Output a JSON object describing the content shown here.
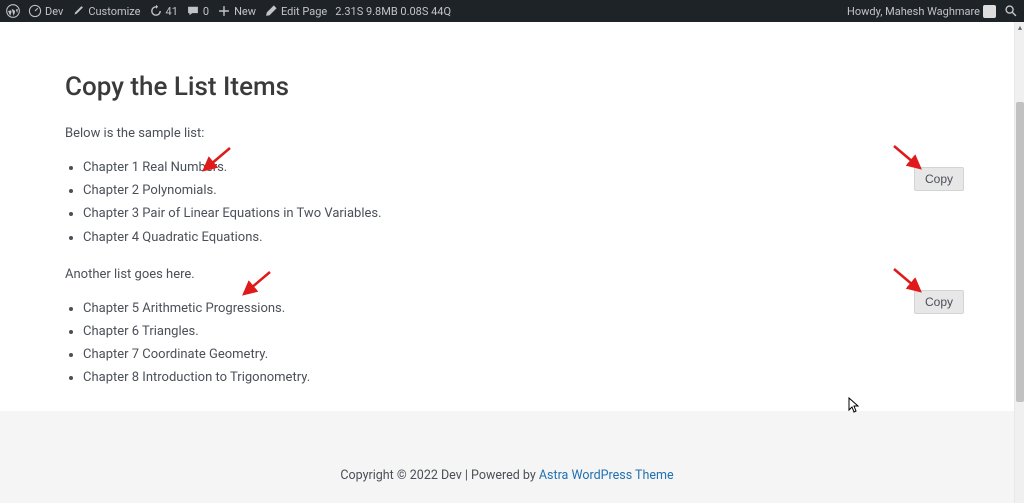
{
  "adminbar": {
    "site_name": "Dev",
    "customize": "Customize",
    "updates_count": "41",
    "comments_count": "0",
    "new": "New",
    "edit_page": "Edit Page",
    "perf": "2.31S  9.8MB  0.08S  44Q",
    "howdy": "Howdy, Mahesh Waghmare"
  },
  "page": {
    "title": "Copy the List Items",
    "intro": "Below is the sample list:",
    "list1": [
      "Chapter 1 Real Numbers.",
      "Chapter 2 Polynomials.",
      "Chapter 3 Pair of Linear Equations in Two Variables.",
      "Chapter 4 Quadratic Equations."
    ],
    "mid": "Another list goes here.",
    "list2": [
      "Chapter 5 Arithmetic Progressions.",
      "Chapter 6 Triangles.",
      "Chapter 7 Coordinate Geometry.",
      "Chapter 8 Introduction to Trigonometry."
    ],
    "copy_label": "Copy"
  },
  "footer": {
    "copyright": "Copyright © 2022 Dev | Powered by ",
    "theme_link": "Astra WordPress Theme"
  }
}
